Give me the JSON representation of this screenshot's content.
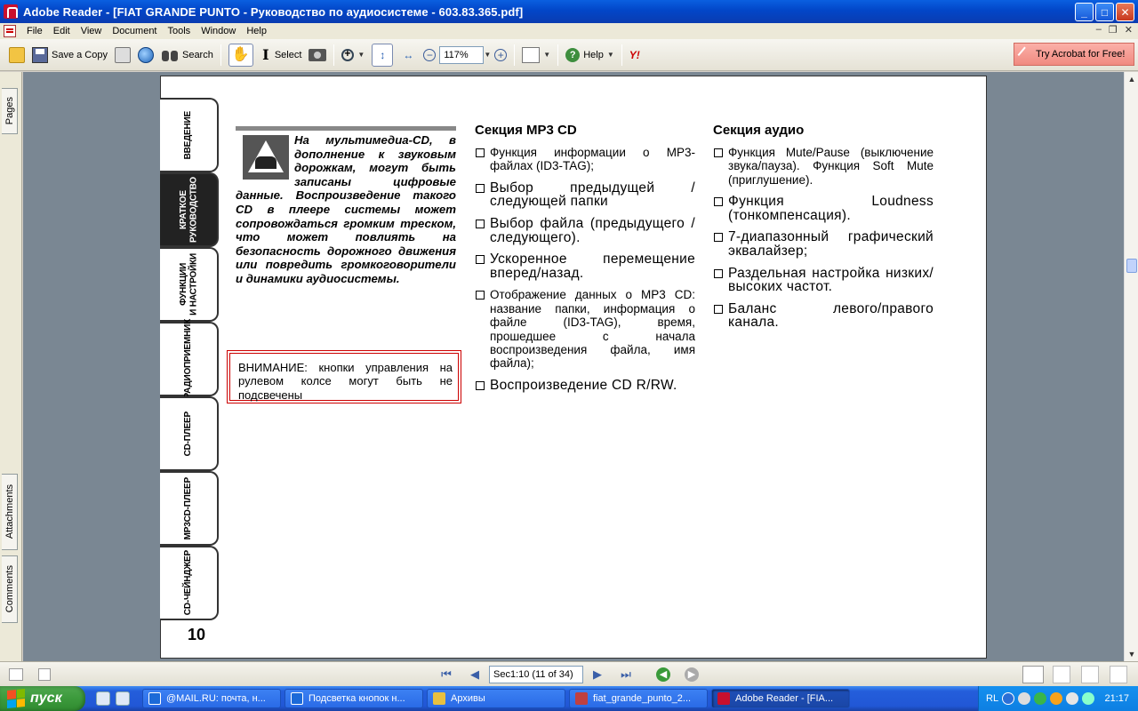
{
  "window": {
    "title": "Adobe Reader - [FIAT GRANDE PUNTO - Руководство по аудиосистеме - 603.83.365.pdf]",
    "controls": {
      "minimize": "_",
      "maximize": "□",
      "close": "✕"
    }
  },
  "menu": {
    "items": [
      "File",
      "Edit",
      "View",
      "Document",
      "Tools",
      "Window",
      "Help"
    ],
    "mdi": {
      "minimize": "–",
      "restore": "❐",
      "close": "✕"
    }
  },
  "toolbar": {
    "save_copy": "Save a Copy",
    "search": "Search",
    "select": "Select",
    "zoom_value": "117%",
    "help": "Help",
    "try_acrobat": "Try Acrobat for Free!",
    "icons": [
      "open-folder-icon",
      "save-disk-icon",
      "print-icon",
      "email-globe-icon",
      "binoculars-icon",
      "hand-icon",
      "select-text-icon",
      "snapshot-camera-icon",
      "zoom-in-icon",
      "fit-page-icon",
      "fit-width-icon",
      "zoom-out-icon",
      "zoom-plus-icon",
      "pages-icon",
      "help-icon",
      "yahoo-icon"
    ]
  },
  "side_tabs": {
    "pages": "Pages",
    "attachments": "Attachments",
    "comments": "Comments"
  },
  "document": {
    "chapter_tabs": [
      "ВВЕДЕНИЕ",
      "КРАТКОЕ\nРУКОВОДСТВО",
      "ФУНКЦИИ\nИ НАСТРОЙКИ",
      "РАДИОПРИЕМНИК",
      "CD-ПЛЕЕР",
      "MP3CD-ПЛЕЕР",
      "CD-ЧЕЙНДЖЕР"
    ],
    "active_chapter": "КРАТКОЕ\nРУКОВОДСТВО",
    "page_number": "10",
    "warning_text": "На мультимедиа-CD, в дополнение к звуковым дорожкам, могут быть записаны цифровые данные. Воспроизведение такого CD в плеере системы может сопровождаться громким треском, что может повлиять на безопасность дорожного движения или повредить громкоговорители и динамики аудиосистемы.",
    "notice_text": "ВНИМАНИЕ: кнопки управления на рулевом колсе могут быть не подсвечены",
    "mp3_section": {
      "heading": "Секция MP3 CD",
      "items": [
        "Функция информации о МР3-файлах (ID3-TAG);",
        "Выбор предыдущей / следующей папки",
        "Выбор файла (предыдущего / следующего).",
        "Ускоренное перемещение вперед/назад.",
        "Отображение данных о МР3 CD: название папки, информация о файле (ID3-TAG), время, прошедшее с начала воспроизведения файла, имя файла);",
        "Воспроизведение CD R/RW."
      ]
    },
    "audio_section": {
      "heading": "Секция аудио",
      "items": [
        "Функция Mute/Pause (выключение звука/пауза). Функция Soft Mute (приглушение).",
        "Функция Loudness (тонкомпенсация).",
        "7-диапазонный графический эквалайзер;",
        "Раздельная настройка низких/высоких частот.",
        "Баланс левого/правого канала."
      ]
    }
  },
  "statusbar": {
    "page_field": "Sec1:10 (11 of 34)",
    "first": "⏮",
    "prev": "◀",
    "next": "▶",
    "last": "⏭",
    "back": "◀",
    "forward": "▶"
  },
  "taskbar": {
    "start": "пуск",
    "tasks": [
      {
        "label": "@MAIL.RU: почта, н...",
        "color": "#1c6ad8"
      },
      {
        "label": "Подсветка кнопок н...",
        "color": "#1c6ad8"
      },
      {
        "label": "Архивы",
        "color": "#e8c040"
      },
      {
        "label": "fiat_grande_punto_2...",
        "color": "#c04040"
      },
      {
        "label": "Adobe Reader - [FIA...",
        "color": "#c8102e"
      }
    ],
    "tray": {
      "lang": "RL",
      "clock": "21:17"
    }
  }
}
